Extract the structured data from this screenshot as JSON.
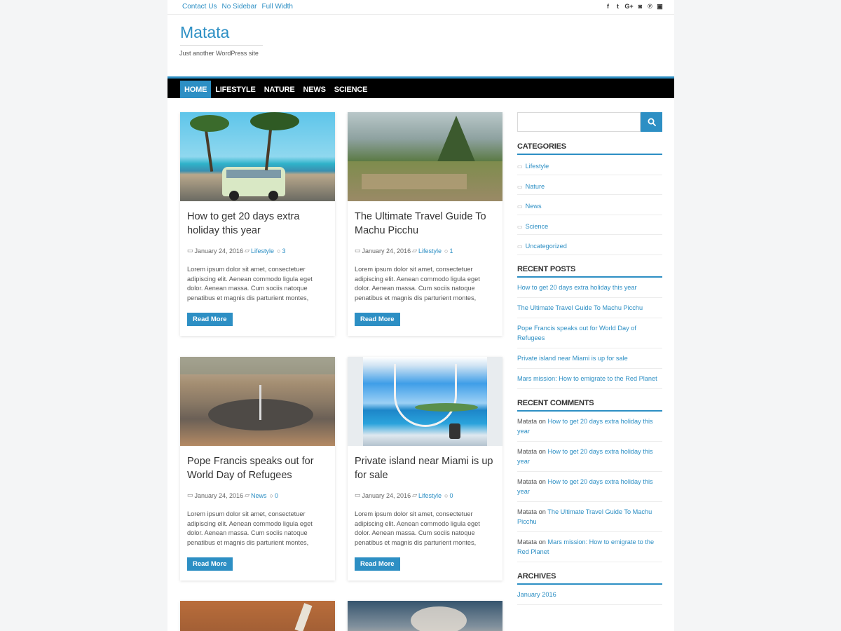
{
  "top_links": [
    "Contact Us",
    "No Sidebar",
    "Full Width"
  ],
  "social_icons": [
    {
      "name": "facebook-icon",
      "glyph": "f"
    },
    {
      "name": "twitter-icon",
      "glyph": "t"
    },
    {
      "name": "google-plus-icon",
      "glyph": "G+"
    },
    {
      "name": "instagram-icon",
      "glyph": "◙"
    },
    {
      "name": "pinterest-icon",
      "glyph": "℗"
    },
    {
      "name": "youtube-icon",
      "glyph": "▣"
    }
  ],
  "site": {
    "title": "Matata",
    "tagline": "Just another WordPress site"
  },
  "nav": [
    "HOME",
    "LIFESTYLE",
    "NATURE",
    "NEWS",
    "SCIENCE"
  ],
  "posts": [
    {
      "title": "How to get 20 days extra holiday this year",
      "date": "January 24, 2016",
      "category": "Lifestyle",
      "comments": "3",
      "excerpt": "Lorem ipsum dolor sit amet, consectetuer adipiscing elit. Aenean commodo ligula eget dolor. Aenean massa. Cum sociis natoque penatibus et magnis dis parturient montes,",
      "button": "Read More",
      "image": "beach-van"
    },
    {
      "title": "The Ultimate Travel Guide To Machu Picchu",
      "date": "January 24, 2016",
      "category": "Lifestyle",
      "comments": "1",
      "excerpt": "Lorem ipsum dolor sit amet, consectetuer adipiscing elit. Aenean commodo ligula eget dolor. Aenean massa. Cum sociis natoque penatibus et magnis dis parturient montes,",
      "button": "Read More",
      "image": "machu-picchu"
    },
    {
      "title": "Pope Francis speaks out for World Day of Refugees",
      "date": "January 24, 2016",
      "category": "News",
      "comments": "0",
      "excerpt": "Lorem ipsum dolor sit amet, consectetuer adipiscing elit. Aenean commodo ligula eget dolor. Aenean massa. Cum sociis natoque penatibus et magnis dis parturient montes,",
      "button": "Read More",
      "image": "vatican"
    },
    {
      "title": "Private island near Miami is up for sale",
      "date": "January 24, 2016",
      "category": "Lifestyle",
      "comments": "0",
      "excerpt": "Lorem ipsum dolor sit amet, consectetuer adipiscing elit. Aenean commodo ligula eget dolor. Aenean massa. Cum sociis natoque penatibus et magnis dis parturient montes,",
      "button": "Read More",
      "image": "boat-ocean"
    }
  ],
  "sidebar": {
    "search_placeholder": "",
    "categories_title": "CATEGORIES",
    "categories": [
      "Lifestyle",
      "Nature",
      "News",
      "Science",
      "Uncategorized"
    ],
    "recent_posts_title": "RECENT POSTS",
    "recent_posts": [
      "How to get 20 days extra holiday this year",
      "The Ultimate Travel Guide To Machu Picchu",
      "Pope Francis speaks out for World Day of Refugees",
      "Private island near Miami is up for sale",
      "Mars mission: How to emigrate to the Red Planet"
    ],
    "recent_comments_title": "RECENT COMMENTS",
    "recent_comments": [
      {
        "author": "Matata",
        "on": "on",
        "post": "How to get 20 days extra holiday this year"
      },
      {
        "author": "Matata",
        "on": "on",
        "post": "How to get 20 days extra holiday this year"
      },
      {
        "author": "Matata",
        "on": "on",
        "post": "How to get 20 days extra holiday this year"
      },
      {
        "author": "Matata",
        "on": "on",
        "post": "The Ultimate Travel Guide To Machu Picchu"
      },
      {
        "author": "Matata",
        "on": "on",
        "post": "Mars mission: How to emigrate to the Red Planet"
      }
    ],
    "archives_title": "ARCHIVES",
    "archives": [
      "January 2016"
    ]
  },
  "colors": {
    "accent": "#2d8fc4",
    "nav_bg": "#000000",
    "page_bg": "#f4f5f6"
  }
}
